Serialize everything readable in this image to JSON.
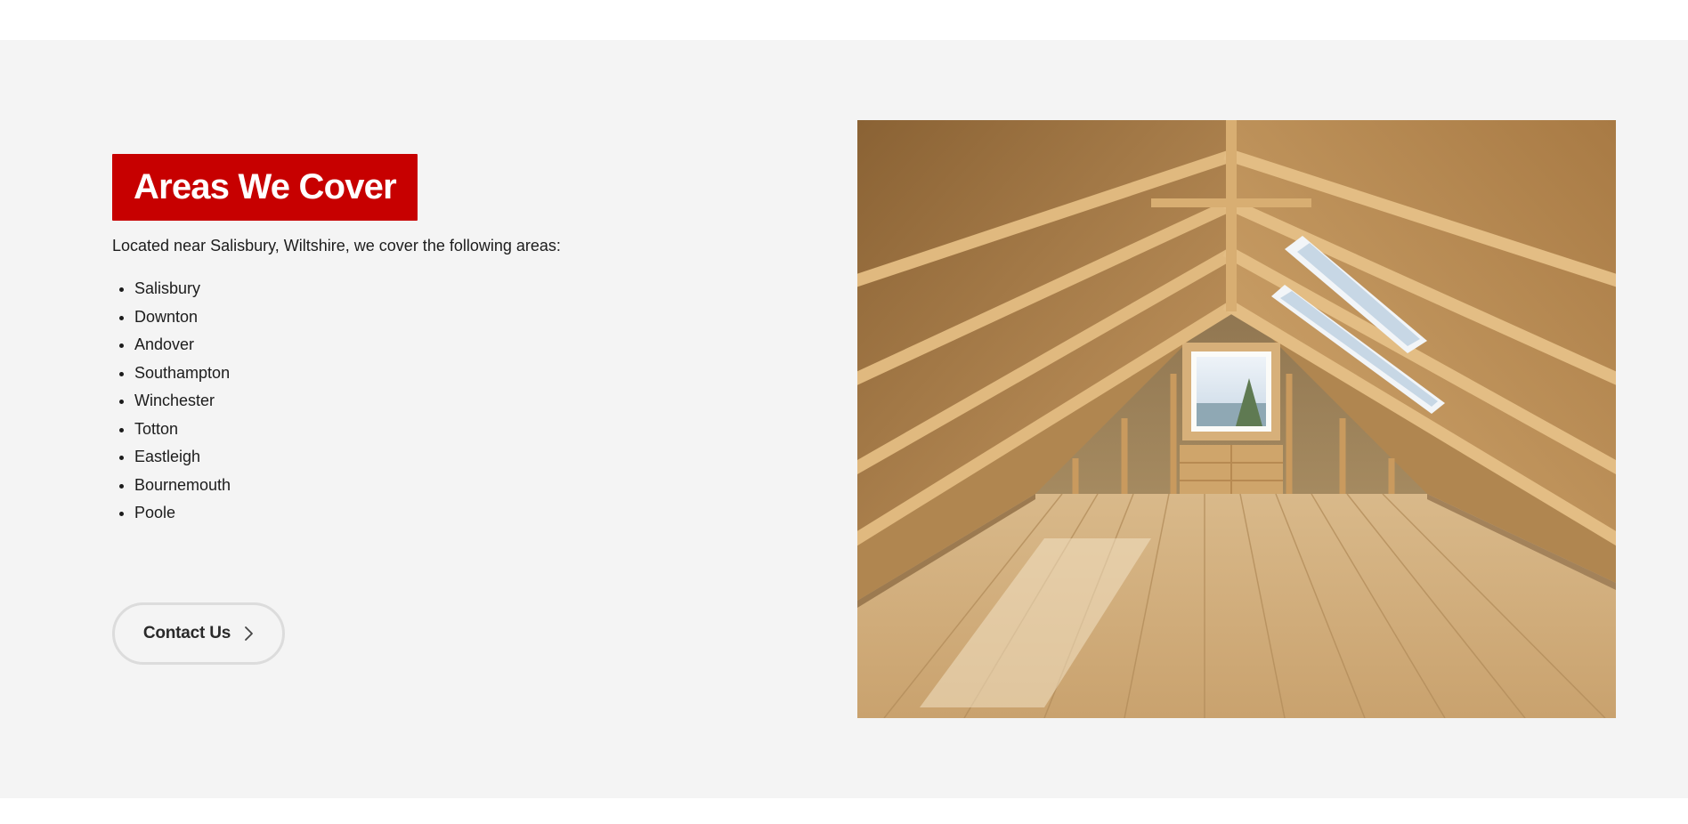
{
  "areas_section": {
    "heading": "Areas We Cover",
    "intro": "Located near Salisbury, Wiltshire, we cover the following areas:",
    "areas": [
      "Salisbury",
      "Downton",
      "Andover",
      "Southampton",
      "Winchester",
      "Totton",
      "Eastleigh",
      "Bournemouth",
      "Poole"
    ],
    "contact_button": {
      "label": "Contact Us",
      "icon": "chevron-right-icon"
    },
    "image": {
      "subject": "loft-conversion-photo"
    }
  },
  "colors": {
    "accent_red": "#c70000",
    "section_background": "#f4f4f4",
    "page_background": "#ffffff",
    "text": "#1c1c1c"
  }
}
